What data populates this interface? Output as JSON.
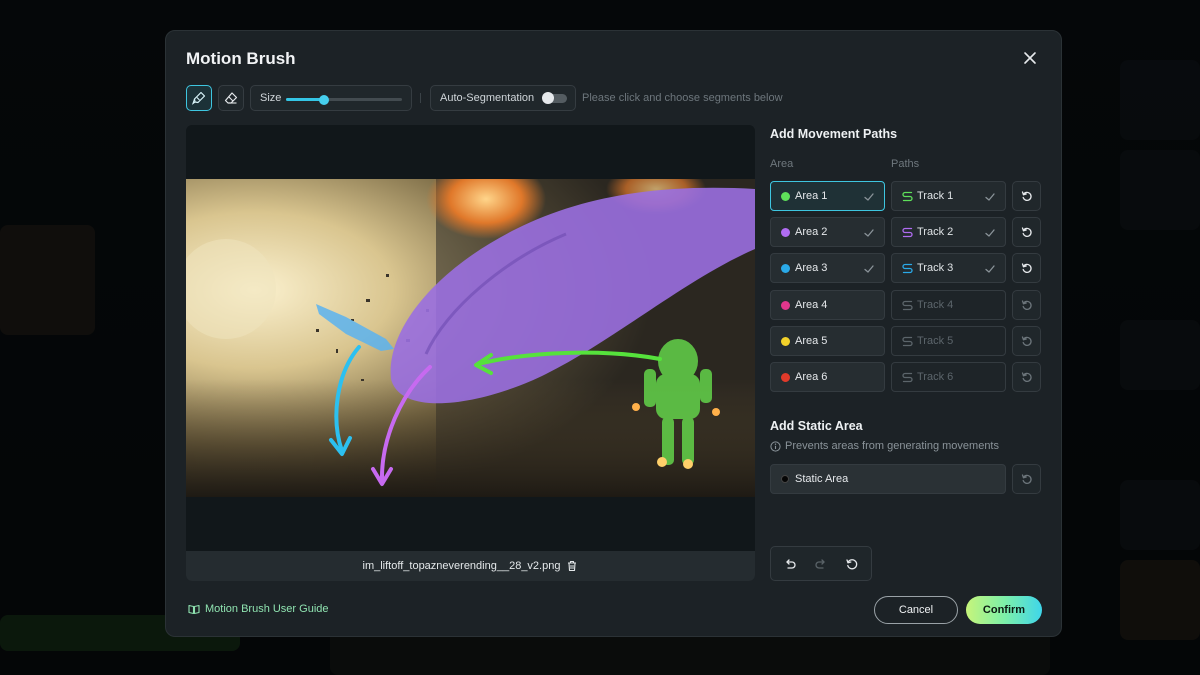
{
  "dialog": {
    "title": "Motion Brush",
    "toolbar": {
      "size_label": "Size",
      "size_value": 0.33,
      "auto_segmentation_label": "Auto-Segmentation",
      "auto_segmentation_on": false,
      "hint": "Please click and choose segments below"
    },
    "canvas": {
      "filename": "im_liftoff_topazneverending__28_v2.png"
    },
    "movement": {
      "title": "Add Movement Paths",
      "area_header": "Area",
      "paths_header": "Paths",
      "rows": [
        {
          "area": "Area 1",
          "color": "#5ee05a",
          "track": "Track 1",
          "track_color": "#5ee05a",
          "done": true,
          "selected": true
        },
        {
          "area": "Area 2",
          "color": "#b06cf2",
          "track": "Track 2",
          "track_color": "#b06cf2",
          "done": true,
          "selected": false
        },
        {
          "area": "Area 3",
          "color": "#2aa9e8",
          "track": "Track 3",
          "track_color": "#2aa9e8",
          "done": true,
          "selected": false
        },
        {
          "area": "Area 4",
          "color": "#e0368c",
          "track": "Track 4",
          "track_color": "#5c656b",
          "done": false,
          "selected": false
        },
        {
          "area": "Area 5",
          "color": "#f2d12a",
          "track": "Track 5",
          "track_color": "#5c656b",
          "done": false,
          "selected": false
        },
        {
          "area": "Area 6",
          "color": "#e03a2a",
          "track": "Track 6",
          "track_color": "#5c656b",
          "done": false,
          "selected": false
        }
      ]
    },
    "static": {
      "title": "Add Static Area",
      "note": "Prevents areas from generating movements",
      "button_label": "Static Area"
    },
    "footer": {
      "guide_link": "Motion Brush User Guide",
      "cancel_label": "Cancel",
      "confirm_label": "Confirm"
    }
  }
}
